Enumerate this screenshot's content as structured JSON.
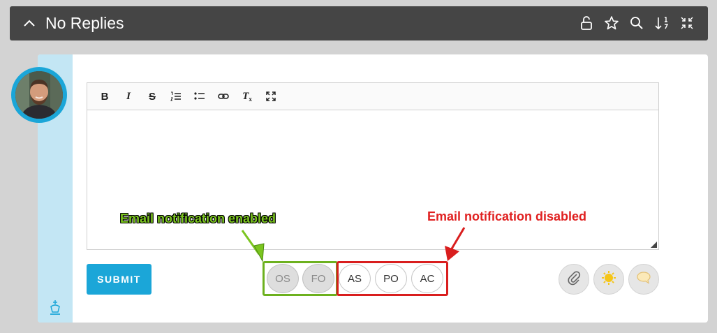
{
  "header": {
    "title": "No Replies",
    "icons": [
      "chevron-up-icon",
      "lock-icon",
      "star-icon",
      "search-icon",
      "sort-icon",
      "collapse-icon"
    ]
  },
  "editor": {
    "toolbar": [
      "bold",
      "italic",
      "strikethrough",
      "numbered-list",
      "bullet-list",
      "link",
      "clear-format",
      "fullscreen"
    ],
    "toolbar_labels": {
      "bold": "B",
      "italic": "I",
      "strike": "S",
      "clear": "T"
    },
    "content": ""
  },
  "annotations": {
    "enabled": "Email notification enabled",
    "disabled": "Email notification disabled"
  },
  "submit_label": "SUBMIT",
  "participants": {
    "enabled": [
      "OS",
      "FO"
    ],
    "disabled": [
      "AS",
      "PO",
      "AC"
    ]
  },
  "actions": [
    "attachment-icon",
    "sun-icon",
    "speech-bubble-icon"
  ],
  "colors": {
    "header_bg": "#454545",
    "accent": "#1ba6d8",
    "stripe": "#c3e6f4",
    "enabled_green": "#7bc51f",
    "disabled_red": "#e02020"
  }
}
